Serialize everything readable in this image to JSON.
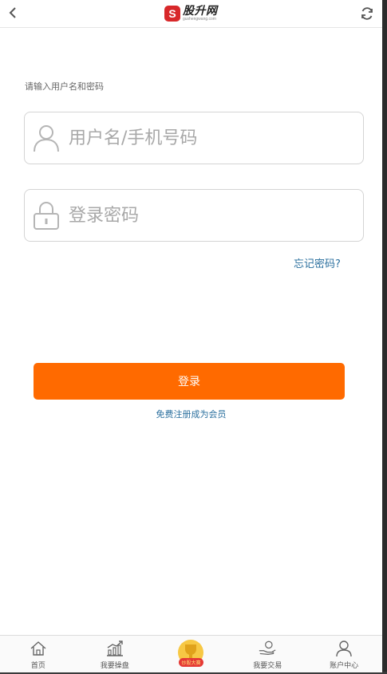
{
  "header": {
    "logo_mark": "S",
    "logo_text": "股升网",
    "logo_subtext": "gushengwang.com"
  },
  "login": {
    "hint": "请输入用户名和密码",
    "username_placeholder": "用户名/手机号码",
    "password_placeholder": "登录密码",
    "forgot": "忘记密码?",
    "submit": "登录",
    "register": "免费注册成为会员"
  },
  "tabbar": {
    "items": [
      {
        "label": "首页",
        "icon": "home-icon"
      },
      {
        "label": "我要操盘",
        "icon": "chart-icon"
      },
      {
        "label": "炒股大赛",
        "icon": "trophy-icon"
      },
      {
        "label": "我要交易",
        "icon": "trade-icon"
      },
      {
        "label": "账户中心",
        "icon": "user-icon"
      }
    ]
  },
  "colors": {
    "accent": "#ff6a00",
    "link": "#2a6f9e",
    "logo": "#d8282a"
  }
}
